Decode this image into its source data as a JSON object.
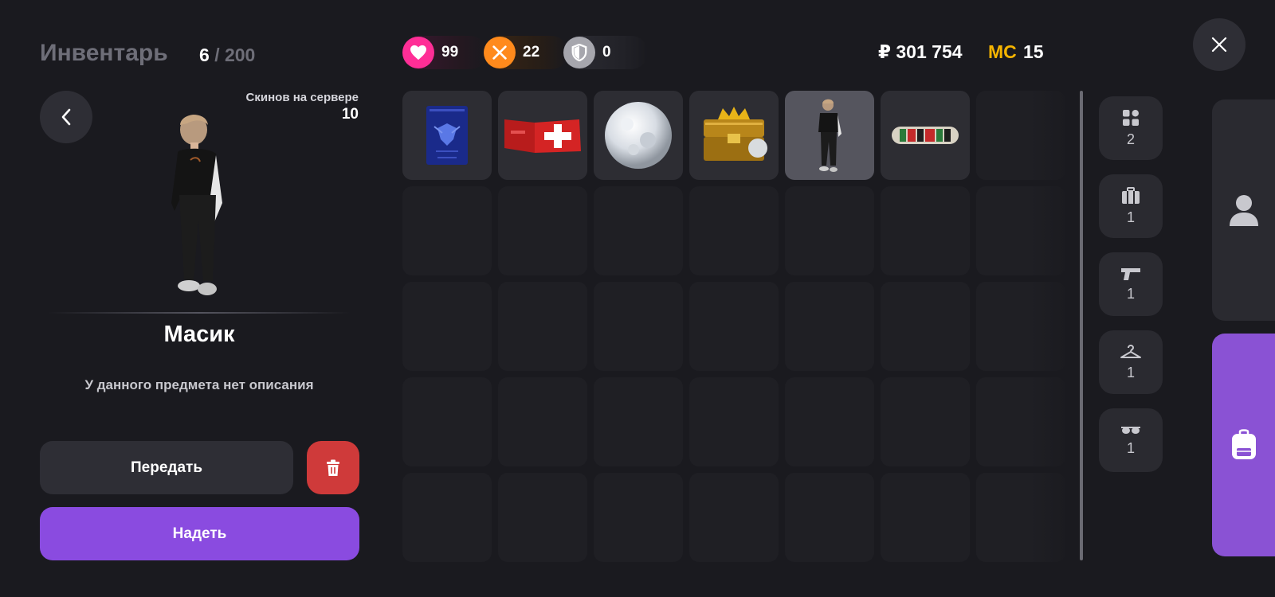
{
  "header": {
    "title": "Инвентарь",
    "count_current": "6",
    "count_separator": "/",
    "count_max": "200"
  },
  "stats": {
    "health": {
      "icon": "heart-icon",
      "value": "99",
      "color": "#ff2e96"
    },
    "food": {
      "icon": "fork-knife-icon",
      "value": "22",
      "color": "#ff8a1c"
    },
    "armor": {
      "icon": "shield-icon",
      "value": "0",
      "color": "#a6a6ad"
    }
  },
  "currency": {
    "money": "₽ 301 754",
    "mc_label": "MC",
    "mc_value": "15"
  },
  "left_panel": {
    "skins_label": "Скинов на сервере",
    "skins_value": "10",
    "item_name": "Масик",
    "item_description": "У данного предмета нет описания",
    "transfer_label": "Передать",
    "equip_label": "Надеть"
  },
  "grid": {
    "columns": 7,
    "rows": 5,
    "items": [
      {
        "name": "passport",
        "icon": "passport-icon"
      },
      {
        "name": "medkit",
        "icon": "medkit-icon"
      },
      {
        "name": "snowball",
        "icon": "snowball-icon"
      },
      {
        "name": "treasure-chest",
        "icon": "treasure-chest-icon"
      },
      {
        "name": "skin",
        "icon": "character-skin-icon",
        "selected": true
      },
      {
        "name": "skateboard",
        "icon": "skateboard-icon"
      }
    ]
  },
  "categories": [
    {
      "icon": "grid-icon",
      "count": "2"
    },
    {
      "icon": "briefcase-icon",
      "count": "1"
    },
    {
      "icon": "pistol-icon",
      "count": "1"
    },
    {
      "icon": "hanger-icon",
      "count": "1"
    },
    {
      "icon": "glasses-icon",
      "count": "1"
    }
  ],
  "side_tabs": [
    {
      "icon": "user-icon",
      "active": false
    },
    {
      "icon": "backpack-icon",
      "active": true
    }
  ],
  "colors": {
    "background": "#1a1a1f",
    "accent_purple": "#8a4be0",
    "danger_red": "#cf3a3a",
    "mc_gold": "#f5b400"
  }
}
